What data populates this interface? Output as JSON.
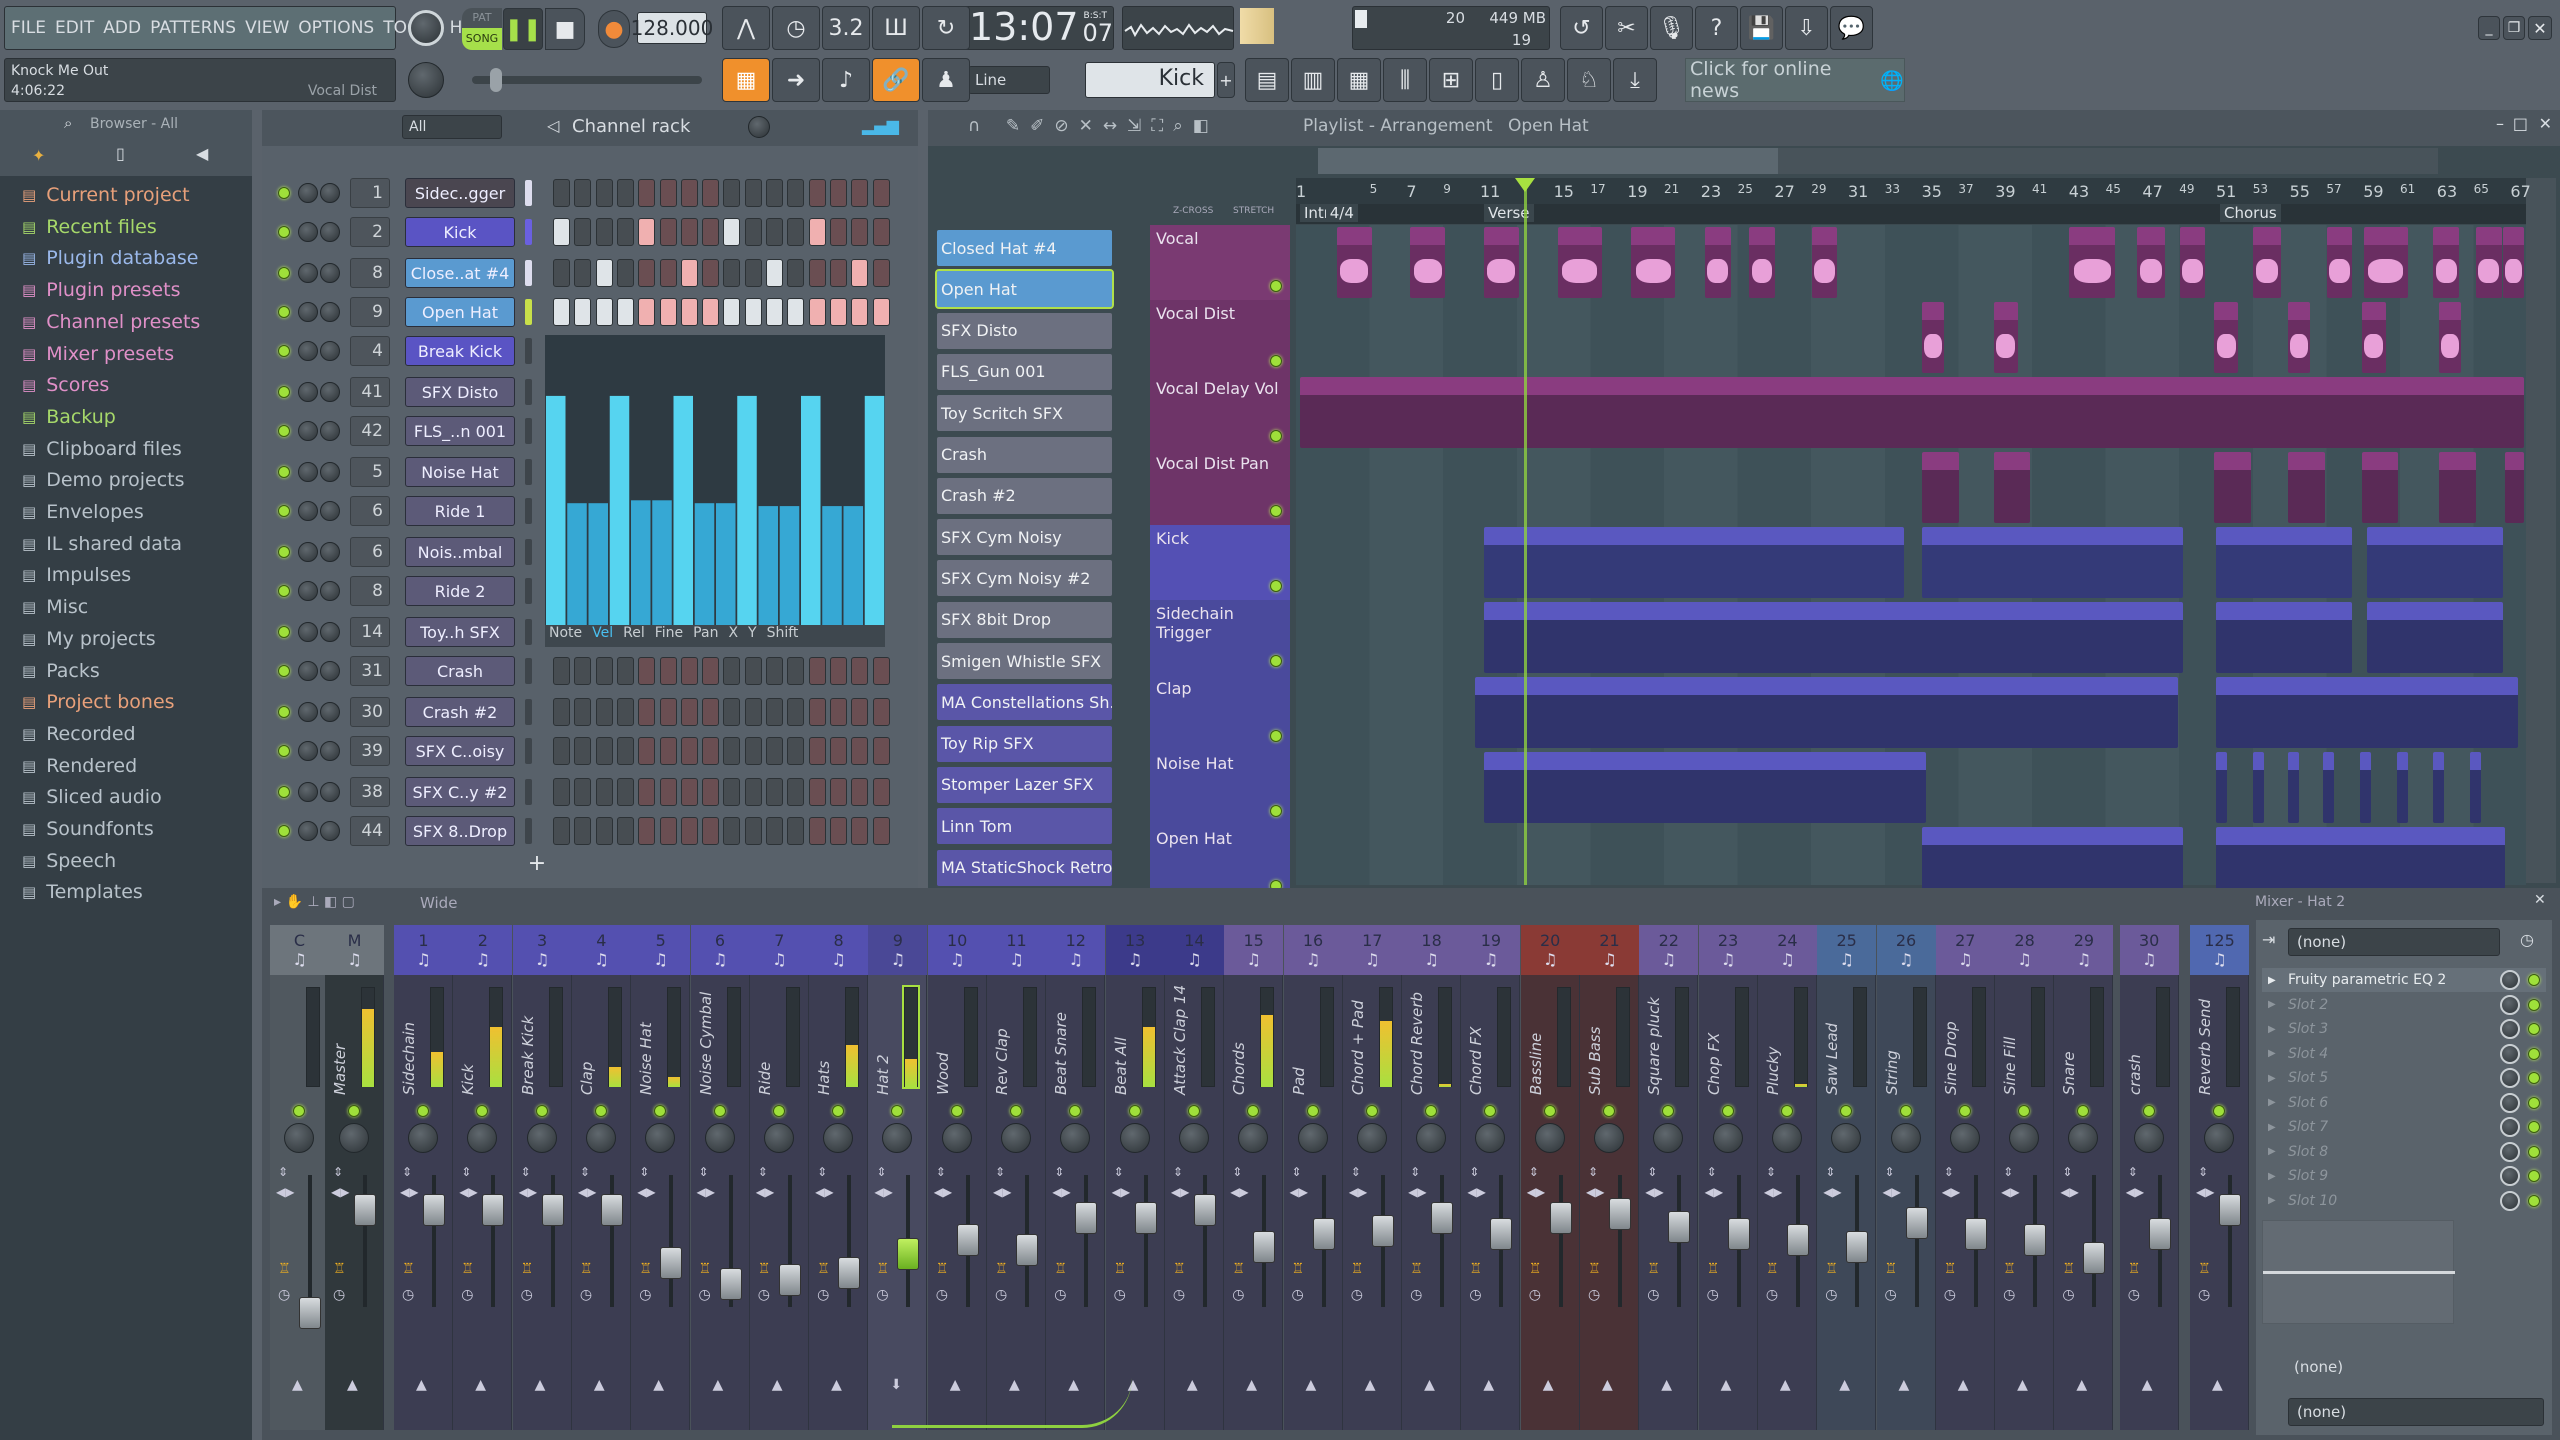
{
  "toolbar": {
    "menu": [
      "FILE",
      "EDIT",
      "ADD",
      "PATTERNS",
      "VIEW",
      "OPTIONS",
      "TOOLS",
      "HELP"
    ],
    "pat_label": "PAT",
    "song_label": "SONG",
    "tempo": "128.000",
    "time": "13:07",
    "time_sub": "07",
    "time_mode": "B:S:T",
    "cpu": "20",
    "memory": "449 MB",
    "polyphony": "19",
    "song_title": "Knock Me Out",
    "song_time": "4:06:22",
    "hint_target": "Vocal Dist",
    "snap": "Line",
    "pattern": "Kick",
    "news": "Click for online news",
    "accent": "#f0902c"
  },
  "browser": {
    "title": "Browser - All",
    "items": [
      {
        "label": "Current project",
        "color": "#e8a07a",
        "icon": "project-icon"
      },
      {
        "label": "Recent files",
        "color": "#a6d86a",
        "icon": "recent-icon"
      },
      {
        "label": "Plugin database",
        "color": "#9ab8ea",
        "icon": "plugin-icon"
      },
      {
        "label": "Plugin presets",
        "color": "#e090c8",
        "icon": "plugin-icon"
      },
      {
        "label": "Channel presets",
        "color": "#e090c8",
        "icon": "channel-icon"
      },
      {
        "label": "Mixer presets",
        "color": "#e090c8",
        "icon": "mixer-icon"
      },
      {
        "label": "Scores",
        "color": "#e090c8",
        "icon": "note-icon"
      },
      {
        "label": "Backup",
        "color": "#a6d86a",
        "icon": "recent-icon"
      },
      {
        "label": "Clipboard files",
        "color": "#b8c2ca",
        "icon": "folder-icon"
      },
      {
        "label": "Demo projects",
        "color": "#b8c2ca",
        "icon": "folder-icon"
      },
      {
        "label": "Envelopes",
        "color": "#b8c2ca",
        "icon": "folder-icon"
      },
      {
        "label": "IL shared data",
        "color": "#b8c2ca",
        "icon": "folder-icon"
      },
      {
        "label": "Impulses",
        "color": "#b8c2ca",
        "icon": "folder-icon"
      },
      {
        "label": "Misc",
        "color": "#b8c2ca",
        "icon": "folder-icon"
      },
      {
        "label": "My projects",
        "color": "#b8c2ca",
        "icon": "folder-icon"
      },
      {
        "label": "Packs",
        "color": "#b8c2ca",
        "icon": "packs-icon"
      },
      {
        "label": "Project bones",
        "color": "#e8a07a",
        "icon": "folder-icon"
      },
      {
        "label": "Recorded",
        "color": "#b8c2ca",
        "icon": "wave-icon"
      },
      {
        "label": "Rendered",
        "color": "#b8c2ca",
        "icon": "wave-icon"
      },
      {
        "label": "Sliced audio",
        "color": "#b8c2ca",
        "icon": "wave-icon"
      },
      {
        "label": "Soundfonts",
        "color": "#b8c2ca",
        "icon": "folder-icon"
      },
      {
        "label": "Speech",
        "color": "#b8c2ca",
        "icon": "folder-icon"
      },
      {
        "label": "Templates",
        "color": "#b8c2ca",
        "icon": "folder-icon"
      }
    ]
  },
  "channel_rack": {
    "title": "Channel rack",
    "filter": "All",
    "graph_tabs": [
      "Note",
      "Vel",
      "Rel",
      "Fine",
      "Pan",
      "X",
      "Y",
      "Shift"
    ],
    "graph_active": "Vel",
    "velocity": [
      0.79,
      0.42,
      0.42,
      0.79,
      0.43,
      0.43,
      0.79,
      0.42,
      0.42,
      0.79,
      0.41,
      0.41,
      0.79,
      0.41,
      0.41,
      0.79
    ],
    "channels": [
      {
        "num": "1",
        "name": "Sidec..gger",
        "kind": "dark",
        "steps": [
          0,
          0,
          0,
          0,
          0,
          0,
          0,
          0,
          0,
          0,
          0,
          0,
          0,
          0,
          0,
          0
        ]
      },
      {
        "num": "2",
        "name": "Kick",
        "kind": "kick",
        "steps": [
          1,
          0,
          0,
          0,
          1,
          0,
          0,
          0,
          1,
          0,
          0,
          0,
          1,
          0,
          0,
          0
        ]
      },
      {
        "num": "8",
        "name": "Close..at #4",
        "kind": "hat",
        "steps": [
          0,
          0,
          1,
          0,
          0,
          0,
          1,
          0,
          0,
          0,
          1,
          0,
          0,
          0,
          1,
          0
        ]
      },
      {
        "num": "9",
        "name": "Open Hat",
        "kind": "hat",
        "steps": [
          1,
          1,
          1,
          1,
          1,
          1,
          1,
          1,
          1,
          1,
          1,
          1,
          1,
          1,
          1,
          1
        ]
      },
      {
        "num": "4",
        "name": "Break Kick",
        "kind": "kick"
      },
      {
        "num": "41",
        "name": "SFX Disto",
        "kind": "gray"
      },
      {
        "num": "42",
        "name": "FLS_..n 001",
        "kind": "gray"
      },
      {
        "num": "5",
        "name": "Noise Hat",
        "kind": "gray"
      },
      {
        "num": "6",
        "name": "Ride 1",
        "kind": "gray"
      },
      {
        "num": "6",
        "name": "Nois..mbal",
        "kind": "gray"
      },
      {
        "num": "8",
        "name": "Ride 2",
        "kind": "gray"
      },
      {
        "num": "14",
        "name": "Toy..h SFX",
        "kind": "gray"
      },
      {
        "num": "31",
        "name": "Crash",
        "kind": "gray",
        "steps": [
          0,
          0,
          0,
          0,
          0,
          0,
          0,
          0,
          0,
          0,
          0,
          0,
          0,
          0,
          0,
          0
        ]
      },
      {
        "num": "30",
        "name": "Crash #2",
        "kind": "gray",
        "steps": [
          0,
          0,
          0,
          0,
          0,
          0,
          0,
          0,
          0,
          0,
          0,
          0,
          0,
          0,
          0,
          0
        ]
      },
      {
        "num": "39",
        "name": "SFX C..oisy",
        "kind": "gray",
        "steps": [
          0,
          0,
          0,
          0,
          0,
          0,
          0,
          0,
          0,
          0,
          0,
          0,
          0,
          0,
          0,
          0
        ]
      },
      {
        "num": "38",
        "name": "SFX C..y #2",
        "kind": "gray",
        "steps": [
          0,
          0,
          0,
          0,
          0,
          0,
          0,
          0,
          0,
          0,
          0,
          0,
          0,
          0,
          0,
          0
        ]
      },
      {
        "num": "44",
        "name": "SFX 8..Drop",
        "kind": "gray",
        "steps": [
          0,
          0,
          0,
          0,
          0,
          0,
          0,
          0,
          0,
          0,
          0,
          0,
          0,
          0,
          0,
          0
        ]
      }
    ]
  },
  "playlist": {
    "title": "Playlist - Arrangement",
    "pattern": "Open Hat",
    "zcross": "Z-CROSS",
    "stretch": "STRETCH",
    "bar_labels": [
      "1",
      "5",
      "7",
      "9",
      "11",
      "15",
      "17",
      "19",
      "21",
      "23",
      "25",
      "27",
      "29",
      "31",
      "33",
      "35",
      "37",
      "39",
      "41",
      "43",
      "45",
      "47",
      "49",
      "51",
      "53",
      "55",
      "57",
      "59",
      "61",
      "63",
      "65",
      "67"
    ],
    "markers": [
      {
        "label": "Intro",
        "bar": 1
      },
      {
        "label": "4/4",
        "bar": 2.4
      },
      {
        "label": "Verse",
        "bar": 11
      },
      {
        "label": "Chorus",
        "bar": 51
      }
    ],
    "playhead_bar": 13.2,
    "picker": [
      {
        "label": "Closed Hat #4",
        "kind": "hat"
      },
      {
        "label": "Open Hat",
        "kind": "hat"
      },
      {
        "label": "SFX Disto",
        "kind": "audio"
      },
      {
        "label": "FLS_Gun 001",
        "kind": "audio"
      },
      {
        "label": "Toy Scritch SFX",
        "kind": "audio"
      },
      {
        "label": "Crash",
        "kind": "audio"
      },
      {
        "label": "Crash #2",
        "kind": "audio"
      },
      {
        "label": "SFX Cym Noisy",
        "kind": "audio"
      },
      {
        "label": "SFX Cym Noisy #2",
        "kind": "audio"
      },
      {
        "label": "SFX 8bit Drop",
        "kind": "audio"
      },
      {
        "label": "Smigen Whistle SFX",
        "kind": "audio"
      },
      {
        "label": "MA Constellations Sh..",
        "kind": "purple"
      },
      {
        "label": "Toy Rip SFX",
        "kind": "purple"
      },
      {
        "label": "Stomper Lazer SFX",
        "kind": "purple"
      },
      {
        "label": "Linn Tom",
        "kind": "purple"
      },
      {
        "label": "MA StaticShock Retro..",
        "kind": "purple"
      }
    ],
    "tracks": [
      {
        "name": "Vocal",
        "color": "#7a3a72",
        "clip_color": "#6a2e62",
        "clip_label": "Vocal",
        "clips": [
          [
            3,
            4.9
          ],
          [
            7,
            8.9
          ],
          [
            11,
            12.9
          ],
          [
            15,
            17.4
          ],
          [
            19,
            21.4
          ],
          [
            23,
            24.4
          ],
          [
            25.4,
            26.8
          ],
          [
            28.8,
            30.2
          ],
          [
            42.8,
            45.3
          ],
          [
            46.5,
            48
          ],
          [
            48.8,
            50.2
          ],
          [
            52.8,
            54.3
          ],
          [
            56.8,
            58.2
          ],
          [
            58.8,
            61.2
          ],
          [
            62.6,
            64
          ],
          [
            64.9,
            66.3
          ],
          [
            66.4,
            67.5
          ]
        ]
      },
      {
        "name": "Vocal Dist",
        "color": "#6e3468",
        "clip_color": "#6a2e62",
        "clips": [
          [
            34.8,
            36
          ],
          [
            38.7,
            40
          ],
          [
            50.7,
            52
          ],
          [
            54.7,
            55.9
          ],
          [
            58.7,
            60
          ],
          [
            62.9,
            64.1
          ]
        ]
      },
      {
        "name": "Vocal Delay Vol",
        "color": "#6e3468",
        "clip_color": "#5a2a56",
        "clip_label": "Vocal Delay Vol",
        "clips": [
          [
            1,
            67.5
          ]
        ]
      },
      {
        "name": "Vocal Dist Pan",
        "color": "#6e3468",
        "clip_color": "#5a2a56",
        "clip_label": "V..",
        "clips": [
          [
            34.8,
            36.8
          ],
          [
            38.7,
            40.7
          ],
          [
            50.7,
            52.7
          ],
          [
            54.7,
            56.7
          ],
          [
            58.7,
            60.7
          ],
          [
            62.9,
            64.9
          ],
          [
            66.5,
            67.5
          ]
        ]
      },
      {
        "name": "Kick",
        "color": "#5450b4",
        "clip_color": "#343a78",
        "clip_label": "K..",
        "clips": [
          [
            11,
            33.8
          ],
          [
            34.8,
            49
          ],
          [
            50.8,
            58.2
          ],
          [
            59,
            66.4
          ]
        ]
      },
      {
        "name": "Sidechain Trigger",
        "color": "#4a4a9c",
        "clip_color": "#30346c",
        "clip_label": "Si..",
        "clips": [
          [
            11,
            49
          ],
          [
            50.8,
            58.2
          ],
          [
            59,
            66.4
          ]
        ]
      },
      {
        "name": "Clap",
        "color": "#4a4a9c",
        "clip_color": "#30346c",
        "clips": [
          [
            10.5,
            48.7
          ],
          [
            50.8,
            67.2
          ]
        ]
      },
      {
        "name": "Noise Hat",
        "color": "#4a4a9c",
        "clip_color": "#30346c",
        "clips": [
          [
            11,
            35
          ],
          [
            50.8,
            51.4
          ],
          [
            52.8,
            53.4
          ],
          [
            54.7,
            55.3
          ],
          [
            56.6,
            57.2
          ],
          [
            58.6,
            59.2
          ],
          [
            60.6,
            61.2
          ],
          [
            62.6,
            63.2
          ],
          [
            64.6,
            65.2
          ]
        ]
      },
      {
        "name": "Open Hat",
        "color": "#4a4a9c",
        "clip_color": "#30346c",
        "clips": [
          [
            34.8,
            49
          ],
          [
            50.8,
            66.5
          ]
        ]
      }
    ]
  },
  "mixer": {
    "title": "Mixer - Hat 2",
    "view": "Wide",
    "strips": [
      {
        "num": "1",
        "name": "Sidechain",
        "color": "#5450b0",
        "level": 0.35,
        "fader": 0.78
      },
      {
        "num": "2",
        "name": "Kick",
        "color": "#5450b0",
        "level": 0.6,
        "fader": 0.78
      },
      {
        "num": "3",
        "name": "Break Kick",
        "color": "#5450b0",
        "level": 0,
        "fader": 0.78
      },
      {
        "num": "4",
        "name": "Clap",
        "color": "#5450b0",
        "level": 0.2,
        "fader": 0.78
      },
      {
        "num": "5",
        "name": "Noise Hat",
        "color": "#5450b0",
        "level": 0.1,
        "fader": 0.38
      },
      {
        "num": "6",
        "name": "Noise Cymbal",
        "color": "#5450b0",
        "level": 0,
        "fader": 0.22
      },
      {
        "num": "7",
        "name": "Ride",
        "color": "#5450b0",
        "level": 0,
        "fader": 0.25
      },
      {
        "num": "8",
        "name": "Hats",
        "color": "#5450b0",
        "level": 0.42,
        "fader": 0.3
      },
      {
        "num": "9",
        "name": "Hat 2",
        "color": "#4a4896",
        "level": 0.28,
        "fader": 0.45,
        "selected": true
      },
      {
        "num": "10",
        "name": "Wood",
        "color": "#5450b0",
        "level": 0,
        "fader": 0.55
      },
      {
        "num": "11",
        "name": "Rev Clap",
        "color": "#5450b0",
        "level": 0,
        "fader": 0.48
      },
      {
        "num": "12",
        "name": "Beat Snare",
        "color": "#5450b0",
        "level": 0,
        "fader": 0.72
      },
      {
        "num": "13",
        "name": "Beat All",
        "color": "#3c3a8a",
        "level": 0.6,
        "fader": 0.72
      },
      {
        "num": "14",
        "name": "Attack Clap 14",
        "color": "#3c3a8a",
        "level": 0,
        "fader": 0.78
      },
      {
        "num": "15",
        "name": "Chords",
        "color": "#6b5a9a",
        "level": 0.72,
        "fader": 0.5
      },
      {
        "num": "16",
        "name": "Pad",
        "color": "#6b5a9a",
        "level": 0,
        "fader": 0.6
      },
      {
        "num": "17",
        "name": "Chord + Pad",
        "color": "#6b5a9a",
        "level": 0.66,
        "fader": 0.62
      },
      {
        "num": "18",
        "name": "Chord Reverb",
        "color": "#6b5a9a",
        "level": 0.03,
        "fader": 0.72
      },
      {
        "num": "19",
        "name": "Chord FX",
        "color": "#6b5a9a",
        "level": 0,
        "fader": 0.6
      },
      {
        "num": "20",
        "name": "Bassline",
        "color": "#8a3a35",
        "level": 0,
        "fader": 0.72
      },
      {
        "num": "21",
        "name": "Sub Bass",
        "color": "#8a3a35",
        "level": 0,
        "fader": 0.75
      },
      {
        "num": "22",
        "name": "Square pluck",
        "color": "#6b5a9a",
        "level": 0,
        "fader": 0.65
      },
      {
        "num": "23",
        "name": "Chop FX",
        "color": "#6b5a9a",
        "level": 0,
        "fader": 0.6
      },
      {
        "num": "24",
        "name": "Plucky",
        "color": "#6b5a9a",
        "level": 0.03,
        "fader": 0.55
      },
      {
        "num": "25",
        "name": "Saw Lead",
        "color": "#4a6a9a",
        "level": 0,
        "fader": 0.5
      },
      {
        "num": "26",
        "name": "String",
        "color": "#4a6a9a",
        "level": 0,
        "fader": 0.68
      },
      {
        "num": "27",
        "name": "Sine Drop",
        "color": "#6b5a9a",
        "level": 0,
        "fader": 0.6
      },
      {
        "num": "28",
        "name": "Sine Fill",
        "color": "#6b5a9a",
        "level": 0,
        "fader": 0.55
      },
      {
        "num": "29",
        "name": "Snare",
        "color": "#6b5a9a",
        "level": 0,
        "fader": 0.42
      },
      {
        "num": "30",
        "name": "crash",
        "color": "#6b5a9a",
        "level": 0,
        "fader": 0.6
      }
    ],
    "master": {
      "label": "M",
      "name": "Master",
      "level": 0.78,
      "fader": 0.78
    },
    "current": {
      "label": "C"
    },
    "send": {
      "num": "125",
      "name": "Reverb Send",
      "color": "#5068b0",
      "fader": 0.78
    },
    "input": "(none)",
    "output": "(none)",
    "sidechain": "(none)",
    "slots": [
      "Fruity parametric EQ 2",
      "Slot 2",
      "Slot 3",
      "Slot 4",
      "Slot 5",
      "Slot 6",
      "Slot 7",
      "Slot 8",
      "Slot 9",
      "Slot 10"
    ]
  }
}
